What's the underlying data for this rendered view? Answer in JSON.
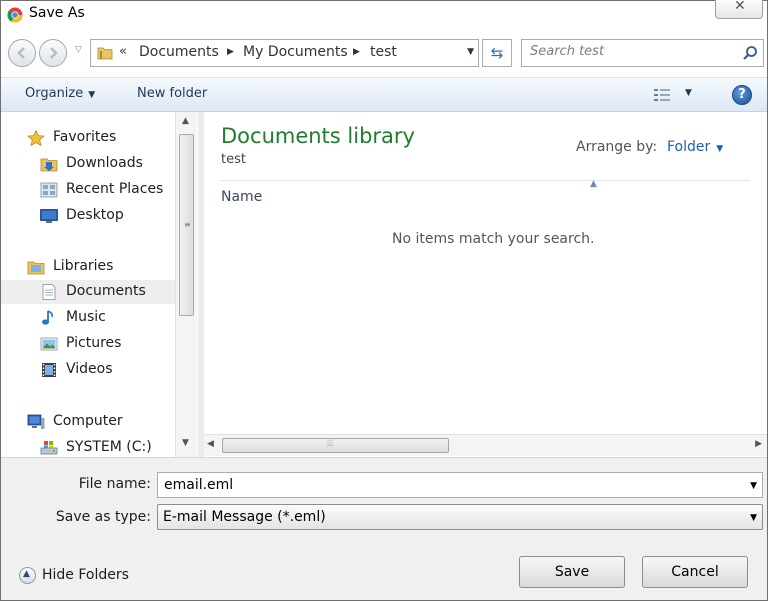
{
  "window": {
    "title": "Save As",
    "close_glyph": "✕"
  },
  "nav": {
    "back_icon": "back-arrow-icon",
    "forward_icon": "forward-arrow-icon",
    "breadcrumb_prefix": "«",
    "breadcrumb": [
      "Documents",
      "My Documents",
      "test"
    ],
    "search_placeholder": "Search test"
  },
  "toolbar": {
    "organize_label": "Organize",
    "new_folder_label": "New folder",
    "help_label": "?"
  },
  "sidebar": {
    "items": [
      {
        "label": "Favorites",
        "icon": "star-icon",
        "level": 0
      },
      {
        "label": "Downloads",
        "icon": "downloads-icon",
        "level": 1
      },
      {
        "label": "Recent Places",
        "icon": "recent-places-icon",
        "level": 1
      },
      {
        "label": "Desktop",
        "icon": "desktop-icon",
        "level": 1
      },
      {
        "label": "Libraries",
        "icon": "libraries-icon",
        "level": 0
      },
      {
        "label": "Documents",
        "icon": "document-icon",
        "level": 1,
        "selected": true
      },
      {
        "label": "Music",
        "icon": "music-icon",
        "level": 1
      },
      {
        "label": "Pictures",
        "icon": "pictures-icon",
        "level": 1
      },
      {
        "label": "Videos",
        "icon": "videos-icon",
        "level": 1
      },
      {
        "label": "Computer",
        "icon": "computer-icon",
        "level": 0
      },
      {
        "label": "SYSTEM (C:)",
        "icon": "drive-icon",
        "level": 1
      }
    ]
  },
  "content": {
    "library_title": "Documents library",
    "library_subtitle": "test",
    "arrange_by_label": "Arrange by:",
    "arrange_by_value": "Folder",
    "column_name": "Name",
    "empty_message": "No items match your search."
  },
  "footer": {
    "file_name_label": "File name:",
    "file_name_value": "email.eml",
    "save_as_type_label": "Save as type:",
    "save_as_type_value": "E-mail Message (*.eml)",
    "hide_folders_label": "Hide Folders",
    "save_label": "Save",
    "cancel_label": "Cancel"
  },
  "colors": {
    "library_title": "#1e7d2f",
    "link_blue": "#1f5fa8",
    "toolbar_text": "#1e395b"
  }
}
